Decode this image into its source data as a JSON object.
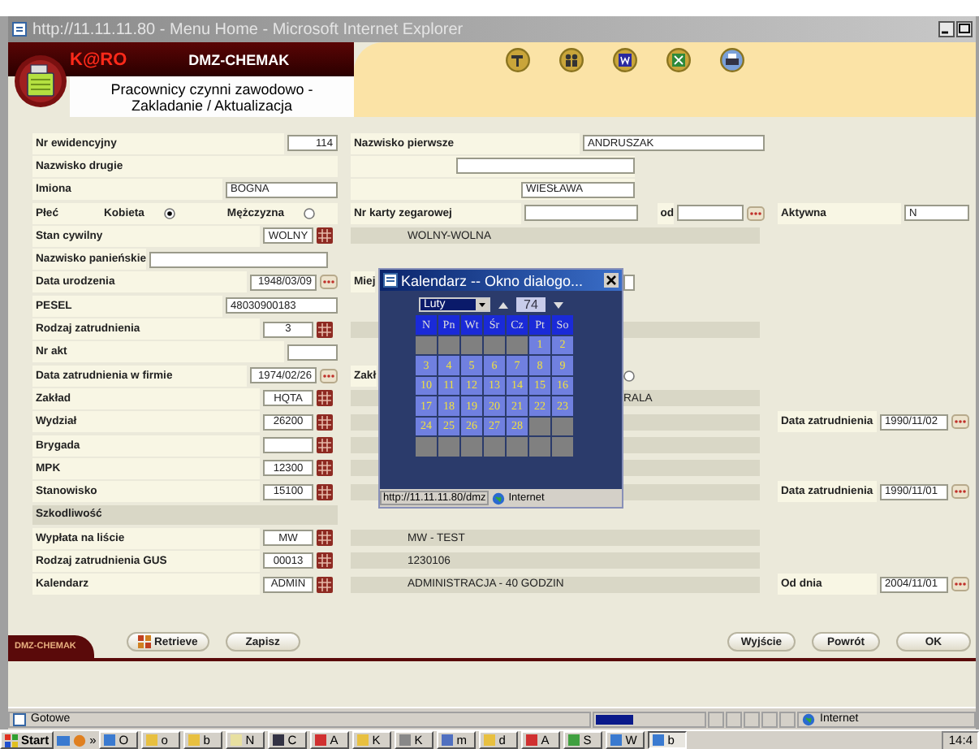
{
  "browser": {
    "title": "http://11.11.11.80 - Menu Home - Microsoft Internet Explorer"
  },
  "header": {
    "brand": "K@RO",
    "app": "DMZ-CHEMAK",
    "title": "Pracownicy czynni zawodowo - Zakladanie / Aktualizacja"
  },
  "rows": [
    {
      "left": {
        "kind": "text",
        "label": "Nr ewidencyjny",
        "value": "114"
      },
      "middle": {
        "kind": "field",
        "label": "Nazwisko pierwsze",
        "value": "ANDRUSZAK"
      }
    },
    {
      "left": {
        "kind": "label",
        "label": "Nazwisko drugie"
      },
      "middle": {
        "kind": "input"
      }
    },
    {
      "left": {
        "kind": "long_text",
        "label": "Imiona",
        "value": "BOGNA"
      },
      "middle": {
        "kind": "short_input",
        "value": "WIESŁAWA"
      }
    },
    {
      "left": {
        "kind": "gender",
        "label": "Płeć",
        "options": [
          {
            "label": "Kobieta",
            "selected": true
          },
          {
            "label": "Mężczyzna",
            "selected": false
          }
        ]
      },
      "middle": {
        "kind": "card",
        "label": "Nr karty zegarowej",
        "from_label": "od"
      },
      "right": {
        "kind": "text",
        "label": "Aktywna",
        "value": "N"
      }
    },
    {
      "left": {
        "kind": "lookup",
        "label": "Stan cywilny",
        "value": "WOLNY"
      },
      "middle": {
        "kind": "strip",
        "text": "WOLNY-WOLNA"
      }
    },
    {
      "left": {
        "kind": "wide_text",
        "label": "Nazwisko panieńskie"
      }
    },
    {
      "left": {
        "kind": "date",
        "label": "Data urodzenia",
        "value": "1948/03/09"
      },
      "middle": {
        "kind": "short_field",
        "label": "Miej"
      }
    },
    {
      "left": {
        "kind": "long_text",
        "label": "PESEL",
        "value": "48030900183"
      }
    },
    {
      "left": {
        "kind": "lookup",
        "label": "Rodzaj zatrudnienia",
        "value": "3"
      },
      "middle": {
        "kind": "strip"
      }
    },
    {
      "left": {
        "kind": "text",
        "label": "Nr akt"
      }
    },
    {
      "left": {
        "kind": "date",
        "label": "Data zatrudnienia w firmie",
        "value": "1974/02/26"
      },
      "middle": {
        "kind": "radio",
        "label": "Zakł",
        "selected": false
      }
    },
    {
      "left": {
        "kind": "lookup",
        "label": "Zakład",
        "value": "HQTA"
      },
      "middle": {
        "kind": "covered_strip",
        "text": "RALA"
      }
    },
    {
      "left": {
        "kind": "lookup",
        "label": "Wydział",
        "value": "26200"
      },
      "middle": {
        "kind": "strip"
      },
      "right": {
        "kind": "date",
        "label": "Data zatrudnienia",
        "value": "1990/11/02"
      }
    },
    {
      "left": {
        "kind": "lookup",
        "label": "Brygada"
      },
      "middle": {
        "kind": "strip"
      }
    },
    {
      "left": {
        "kind": "lookup",
        "label": "MPK",
        "value": "12300"
      },
      "middle": {
        "kind": "strip"
      }
    },
    {
      "left": {
        "kind": "lookup",
        "label": "Stanowisko",
        "value": "15100"
      },
      "middle": {
        "kind": "strip"
      },
      "right": {
        "kind": "date",
        "label": "Data zatrudnienia",
        "value": "1990/11/01"
      }
    },
    {
      "left": {
        "kind": "section",
        "label": "Szkodliwość"
      }
    },
    {
      "left": {
        "kind": "lookup",
        "label": "Wypłata na liście",
        "value": "MW"
      },
      "middle": {
        "kind": "strip",
        "text": "MW - TEST"
      }
    },
    {
      "left": {
        "kind": "lookup",
        "label": "Rodzaj zatrudnienia GUS",
        "value": "00013"
      },
      "middle": {
        "kind": "strip",
        "text": "1230106"
      }
    },
    {
      "left": {
        "kind": "lookup",
        "label": "Kalendarz",
        "value": "ADMIN"
      },
      "middle": {
        "kind": "strip",
        "text": "ADMINISTRACJA - 40 GODZIN"
      },
      "right": {
        "kind": "date",
        "label": "Od dnia",
        "value": "2004/11/01"
      }
    }
  ],
  "calendar": {
    "title": "Kalendarz -- Okno dialogo...",
    "month": "Luty",
    "year": "74",
    "weekdays": [
      "N",
      "Pn",
      "Wt",
      "Śr",
      "Cz",
      "Pt",
      "So"
    ],
    "cells": [
      {
        "kind": "empty"
      },
      {
        "kind": "empty"
      },
      {
        "kind": "empty"
      },
      {
        "kind": "empty"
      },
      {
        "kind": "empty"
      },
      {
        "kind": "day",
        "label": "1"
      },
      {
        "kind": "day",
        "label": "2"
      },
      {
        "kind": "day",
        "label": "3"
      },
      {
        "kind": "day",
        "label": "4"
      },
      {
        "kind": "day",
        "label": "5"
      },
      {
        "kind": "day",
        "label": "6"
      },
      {
        "kind": "day",
        "label": "7"
      },
      {
        "kind": "day",
        "label": "8"
      },
      {
        "kind": "day",
        "label": "9"
      },
      {
        "kind": "day",
        "label": "10"
      },
      {
        "kind": "day",
        "label": "11"
      },
      {
        "kind": "day",
        "label": "12"
      },
      {
        "kind": "day",
        "label": "13"
      },
      {
        "kind": "day",
        "label": "14"
      },
      {
        "kind": "day",
        "label": "15"
      },
      {
        "kind": "day",
        "label": "16"
      },
      {
        "kind": "day",
        "label": "17"
      },
      {
        "kind": "day",
        "label": "18"
      },
      {
        "kind": "day",
        "label": "19"
      },
      {
        "kind": "day",
        "label": "20"
      },
      {
        "kind": "day",
        "label": "21"
      },
      {
        "kind": "day",
        "label": "22"
      },
      {
        "kind": "day",
        "label": "23"
      },
      {
        "kind": "day",
        "label": "24"
      },
      {
        "kind": "day",
        "label": "25"
      },
      {
        "kind": "day",
        "label": "26"
      },
      {
        "kind": "day",
        "label": "27"
      },
      {
        "kind": "day",
        "label": "28"
      },
      {
        "kind": "empty"
      },
      {
        "kind": "empty"
      },
      {
        "kind": "empty"
      },
      {
        "kind": "empty"
      },
      {
        "kind": "empty"
      },
      {
        "kind": "empty"
      },
      {
        "kind": "empty"
      },
      {
        "kind": "empty"
      },
      {
        "kind": "empty"
      }
    ],
    "status_url": "http://11.11.11.80/dmz",
    "status_zone": "Internet"
  },
  "bottom": {
    "tab": "DMZ-CHEMAK",
    "left_buttons": [
      {
        "label": "Retrieve",
        "kind": "icon"
      },
      {
        "label": "Zapisz",
        "kind": "plain"
      }
    ],
    "right_buttons": [
      "Wyjście",
      "Powrót",
      "OK"
    ]
  },
  "status_bar": {
    "text": "Gotowe",
    "progress": {
      "level": 0.35
    },
    "zone": "Internet"
  },
  "taskbar": {
    "start": "Start",
    "overflow": "»",
    "items": [
      {
        "label": "O",
        "selected": false
      },
      {
        "label": "o",
        "selected": false
      },
      {
        "label": "b",
        "selected": false
      },
      {
        "label": "N",
        "selected": false
      },
      {
        "label": "C",
        "selected": false
      },
      {
        "label": "A",
        "selected": false
      },
      {
        "label": "K",
        "selected": false
      },
      {
        "label": "K",
        "selected": false
      },
      {
        "label": "m",
        "selected": false
      },
      {
        "label": "d",
        "selected": false
      },
      {
        "label": "A",
        "selected": false
      },
      {
        "label": "S",
        "selected": false
      },
      {
        "label": "W",
        "selected": false
      },
      {
        "label": "b",
        "selected": true
      }
    ],
    "clock": "14:4"
  }
}
